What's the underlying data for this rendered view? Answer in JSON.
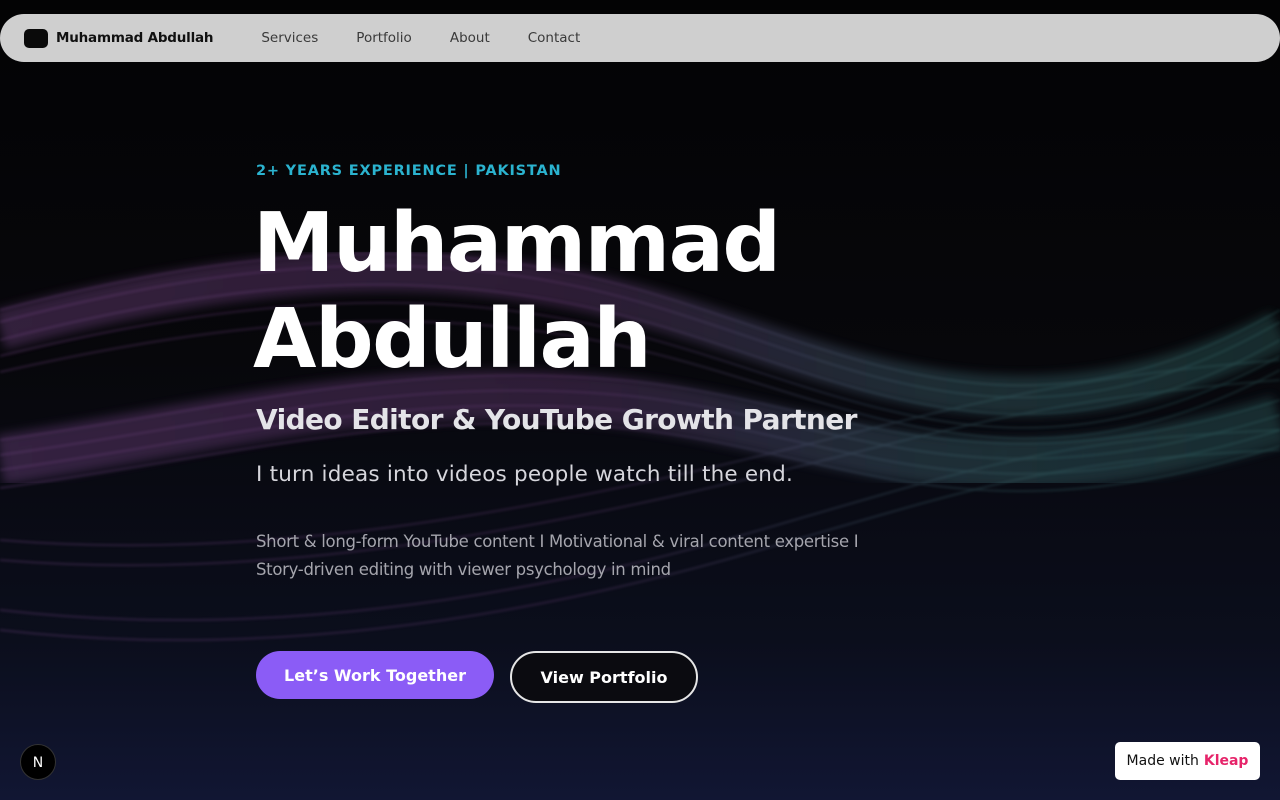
{
  "navbar": {
    "brand_name": "Muhammad Abdullah",
    "links": [
      "Services",
      "Portfolio",
      "About",
      "Contact"
    ]
  },
  "hero": {
    "eyebrow": "2+ YEARS EXPERIENCE | PAKISTAN",
    "title_line1": "Muhammad",
    "title_line2": "Abdullah",
    "subtitle": "Video Editor & YouTube Growth Partner",
    "tagline": "I turn ideas into videos people watch till the end.",
    "description_line1": "Short & long-form YouTube content I Motivational & viral content expertise I",
    "description_line2": "Story-driven editing with viewer psychology in mind"
  },
  "cta": {
    "primary_label": "Let’s Work Together",
    "secondary_label": "View Portfolio"
  },
  "badges": {
    "next_icon_letter": "N",
    "made_with_text": "Made with",
    "made_with_brand": "Kleap"
  },
  "colors": {
    "accent_cyan": "#2bb3cf",
    "primary_button": "#8b5cf6",
    "brand_pink": "#e6246a",
    "navbar_bg": "#cfcfcf"
  },
  "icons": {
    "brand_logo": "rounded-square-logo",
    "next_badge": "nextjs-icon"
  }
}
